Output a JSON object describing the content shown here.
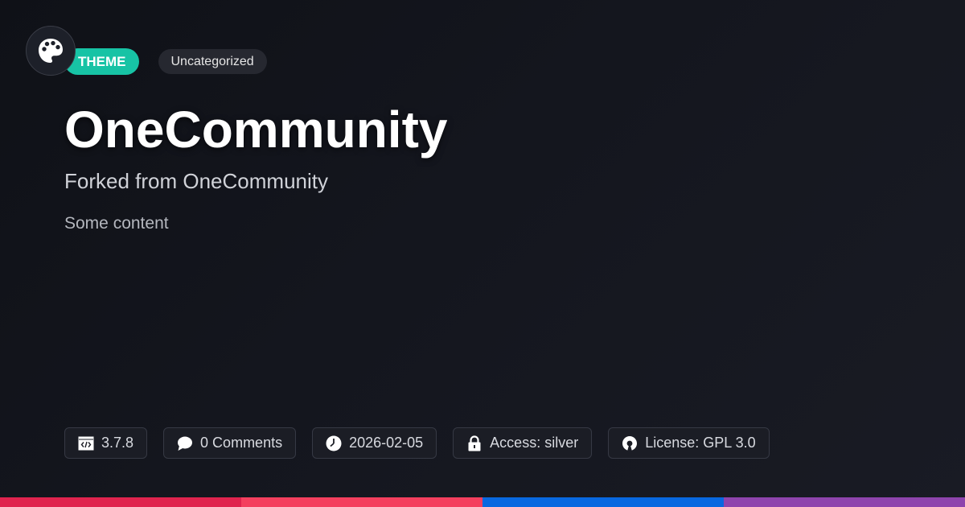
{
  "logo": {
    "icon": "palette-icon"
  },
  "tags": {
    "type": "THEME",
    "category": "Uncategorized"
  },
  "title": "OneCommunity",
  "subtitle": "Forked from OneCommunity",
  "content": "Some content",
  "meta": {
    "version": {
      "icon": "code-icon",
      "text": "3.7.8"
    },
    "comments": {
      "icon": "comment-icon",
      "text": "0 Comments"
    },
    "date": {
      "icon": "clock-icon",
      "text": "2026-02-05"
    },
    "access": {
      "icon": "lock-icon",
      "text": "Access: silver"
    },
    "license": {
      "icon": "open-source-icon",
      "text": "License: GPL 3.0"
    }
  },
  "colors": {
    "accent": "#17c3a5",
    "bar": [
      "#e0234e",
      "#f43f5e",
      "#0868e0",
      "#8e44ad"
    ]
  }
}
